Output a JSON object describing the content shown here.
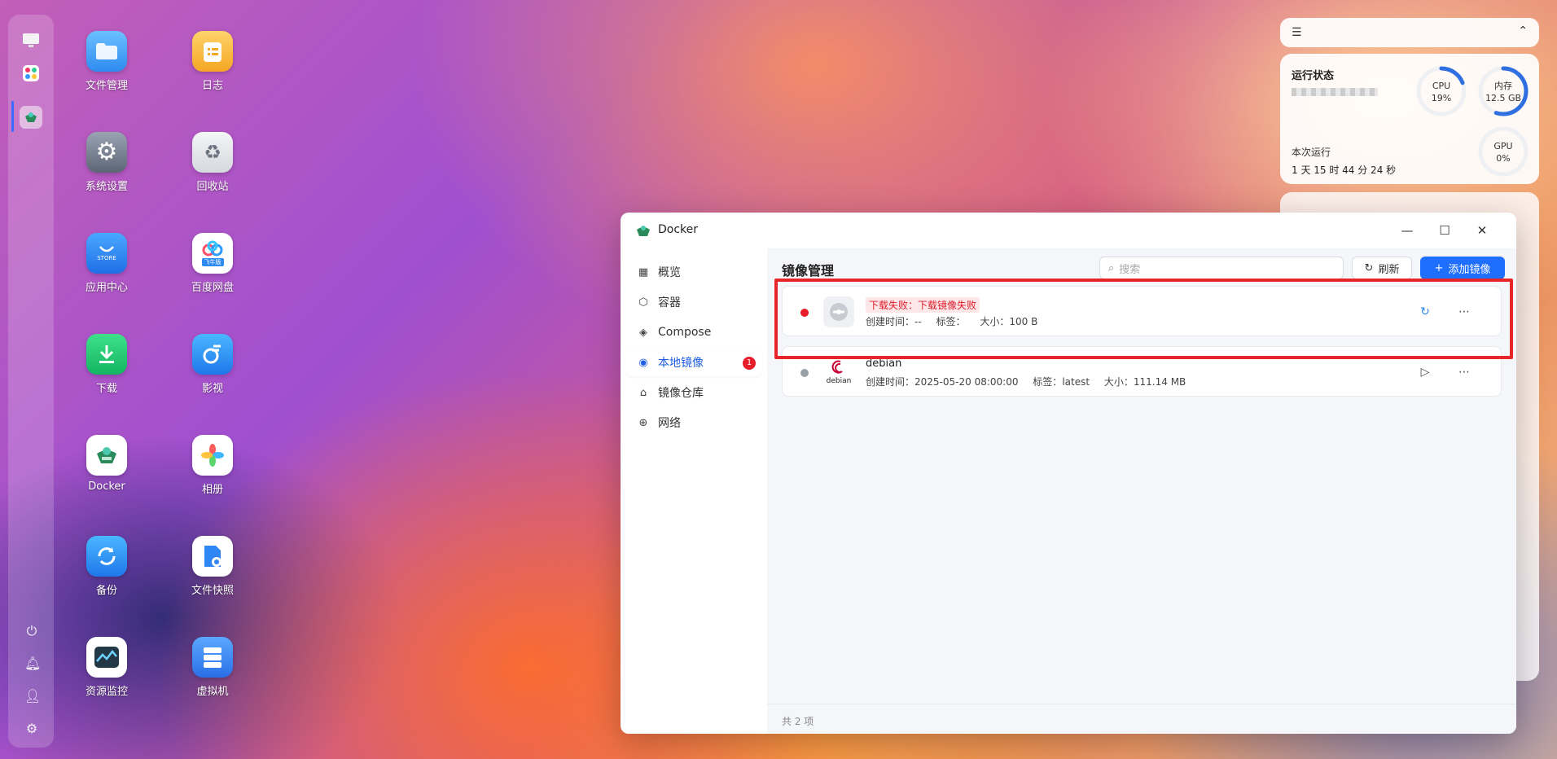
{
  "desktop": {
    "icons": [
      {
        "label": "文件管理",
        "icon": "folder-icon"
      },
      {
        "label": "日志",
        "icon": "log-icon"
      },
      {
        "label": "系统设置",
        "icon": "gear-icon"
      },
      {
        "label": "回收站",
        "icon": "recycle-bin-icon"
      },
      {
        "label": "应用中心",
        "icon": "store-icon"
      },
      {
        "label": "百度网盘",
        "icon": "cloud-drive-icon"
      },
      {
        "label": "下载",
        "icon": "download-icon"
      },
      {
        "label": "影视",
        "icon": "video-icon"
      },
      {
        "label": "Docker",
        "icon": "docker-icon"
      },
      {
        "label": "相册",
        "icon": "photos-icon"
      },
      {
        "label": "备份",
        "icon": "backup-icon"
      },
      {
        "label": "文件快照",
        "icon": "snapshot-icon"
      },
      {
        "label": "资源监控",
        "icon": "monitor-icon"
      },
      {
        "label": "虚拟机",
        "icon": "vm-icon"
      }
    ],
    "store_badge": "STORE",
    "baidu_badge": "飞牛版"
  },
  "status_widget": {
    "title": "运行状态",
    "cpu_label": "CPU",
    "cpu_value": "19%",
    "cpu_fraction": 0.19,
    "mem_label": "内存",
    "mem_value": "12.5 GB",
    "mem_fraction": 0.55,
    "gpu_label": "GPU",
    "gpu_value": "0%",
    "uptime_label": "本次运行",
    "uptime_value": "1 天 15 时 44 分 24 秒",
    "accent": "#2f6fe0"
  },
  "docker_window": {
    "title": "Docker",
    "nav": [
      {
        "label": "概览",
        "icon": "grid-icon"
      },
      {
        "label": "容器",
        "icon": "cube-icon"
      },
      {
        "label": "Compose",
        "icon": "layers-icon"
      },
      {
        "label": "本地镜像",
        "icon": "disk-icon",
        "badge": "1"
      },
      {
        "label": "镜像仓库",
        "icon": "warehouse-icon"
      },
      {
        "label": "网络",
        "icon": "globe-icon"
      }
    ],
    "active_nav": "本地镜像",
    "page_title": "镜像管理",
    "search_placeholder": "搜索",
    "refresh_label": "刷新",
    "add_label": "添加镜像",
    "images": [
      {
        "status_color": "#e81d2a",
        "error_text": "下载失败：下载镜像失败",
        "meta": {
          "created_label": "创建时间：",
          "created": "--",
          "tag_label": "标签：",
          "tag": "",
          "size_label": "大小：",
          "size": "100 B"
        }
      },
      {
        "status_color": "#9aa0a8",
        "name": "debian",
        "logo_text": "debian",
        "meta": {
          "created_label": "创建时间：",
          "created": "2025-05-20 08:00:00",
          "tag_label": "标签：",
          "tag": "latest",
          "size_label": "大小：",
          "size": "111.14 MB"
        }
      }
    ],
    "footer": "共 2 项"
  }
}
